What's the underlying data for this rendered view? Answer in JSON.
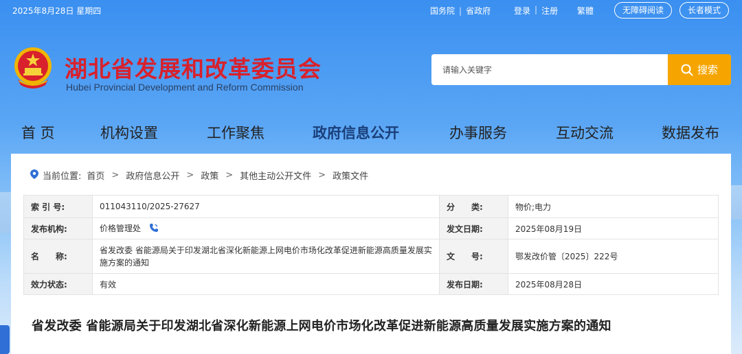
{
  "topbar": {
    "date": "2025年8月28日 星期四",
    "links": [
      "国务院",
      "省政府"
    ],
    "login": "登录",
    "register": "注册",
    "traditional": "繁體",
    "accessibility": "无障碍阅读",
    "elder_mode": "长者模式"
  },
  "header": {
    "title_cn": "湖北省发展和改革委员会",
    "title_en": "Hubei Provincial Development and Reform Commission"
  },
  "search": {
    "placeholder": "请输入关键字",
    "button_label": "搜索"
  },
  "nav": {
    "items": [
      "首 页",
      "机构设置",
      "工作聚焦",
      "政府信息公开",
      "办事服务",
      "互动交流",
      "数据发布"
    ],
    "active": "政府信息公开"
  },
  "breadcrumb": {
    "prefix": "当前位置:",
    "items": [
      "首页",
      "政府信息公开",
      "政策",
      "其他主动公开文件",
      "政策文件"
    ]
  },
  "meta": {
    "index_label": "索 引 号:",
    "index_value": "011043110/2025-27627",
    "category_label": "分　　类:",
    "category_value": "物价;电力",
    "agency_label": "发布机构:",
    "agency_value": "价格管理处",
    "issue_date_label": "发文日期:",
    "issue_date_value": "2025年08月19日",
    "name_label": "名　　称:",
    "name_value": "省发改委 省能源局关于印发湖北省深化新能源上网电价市场化改革促进新能源高质量发展实施方案的通知",
    "doc_no_label": "文　　号:",
    "doc_no_value": "鄂发改价管〔2025〕222号",
    "status_label": "效力状态:",
    "status_value": "有效",
    "publish_date_label": "发布日期:",
    "publish_date_value": "2025年08月28日"
  },
  "document": {
    "title": "省发改委 省能源局关于印发湖北省深化新能源上网电价市场化改革促进新能源高质量发展实施方案的通知"
  },
  "colors": {
    "header_red": "#d8212c",
    "search_button": "#f6a500",
    "sky_blue": "#3a8ff0",
    "nav_active": "#1a3f7a"
  },
  "icons": [
    "emblem-icon",
    "search-icon",
    "location-pin-icon",
    "phone-icon"
  ]
}
